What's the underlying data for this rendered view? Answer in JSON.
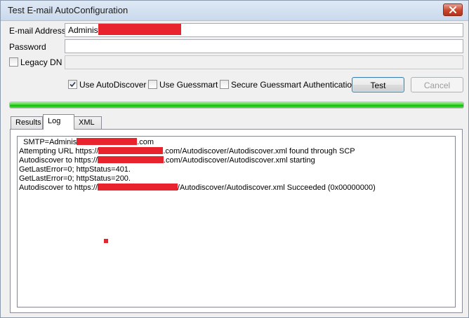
{
  "window": {
    "title": "Test E-mail AutoConfiguration"
  },
  "form": {
    "email_label": "E-mail Address",
    "email_value": "Administ",
    "password_label": "Password",
    "password_value": "",
    "legacy_dn_label": "Legacy DN",
    "legacy_dn_checked": false,
    "legacy_dn_value": ""
  },
  "options": {
    "use_autodiscover_label": "Use AutoDiscover",
    "use_autodiscover_checked": true,
    "use_guessmart_label": "Use Guessmart",
    "use_guessmart_checked": false,
    "secure_guessmart_label": "Secure Guessmart Authentication",
    "secure_guessmart_checked": false
  },
  "buttons": {
    "test_label": "Test",
    "cancel_label": "Cancel"
  },
  "progress": {
    "value": 1.0,
    "color": "#17b80c"
  },
  "tabs": [
    {
      "label": "Results",
      "active": false
    },
    {
      "label": "Log",
      "active": true
    },
    {
      "label": "XML",
      "active": false
    }
  ],
  "log": {
    "lines": [
      {
        "prefix": "  SMTP=Adminis",
        "suffix": ".com"
      },
      {
        "prefix": "Attempting URL https://",
        "suffix": ".com/Autodiscover/Autodiscover.xml found through SCP"
      },
      {
        "prefix": "Autodiscover to https://",
        "suffix": ".com/Autodiscover/Autodiscover.xml starting"
      },
      {
        "prefix": "GetLastError=0; httpStatus=401.",
        "suffix": ""
      },
      {
        "prefix": "GetLastError=0; httpStatus=200.",
        "suffix": ""
      },
      {
        "prefix": "Autodiscover to https://",
        "suffix": "/Autodiscover/Autodiscover.xml Succeeded (0x00000000)"
      }
    ]
  },
  "colors": {
    "redaction": "#e8232e",
    "accent_border": "#3c7fb1"
  }
}
